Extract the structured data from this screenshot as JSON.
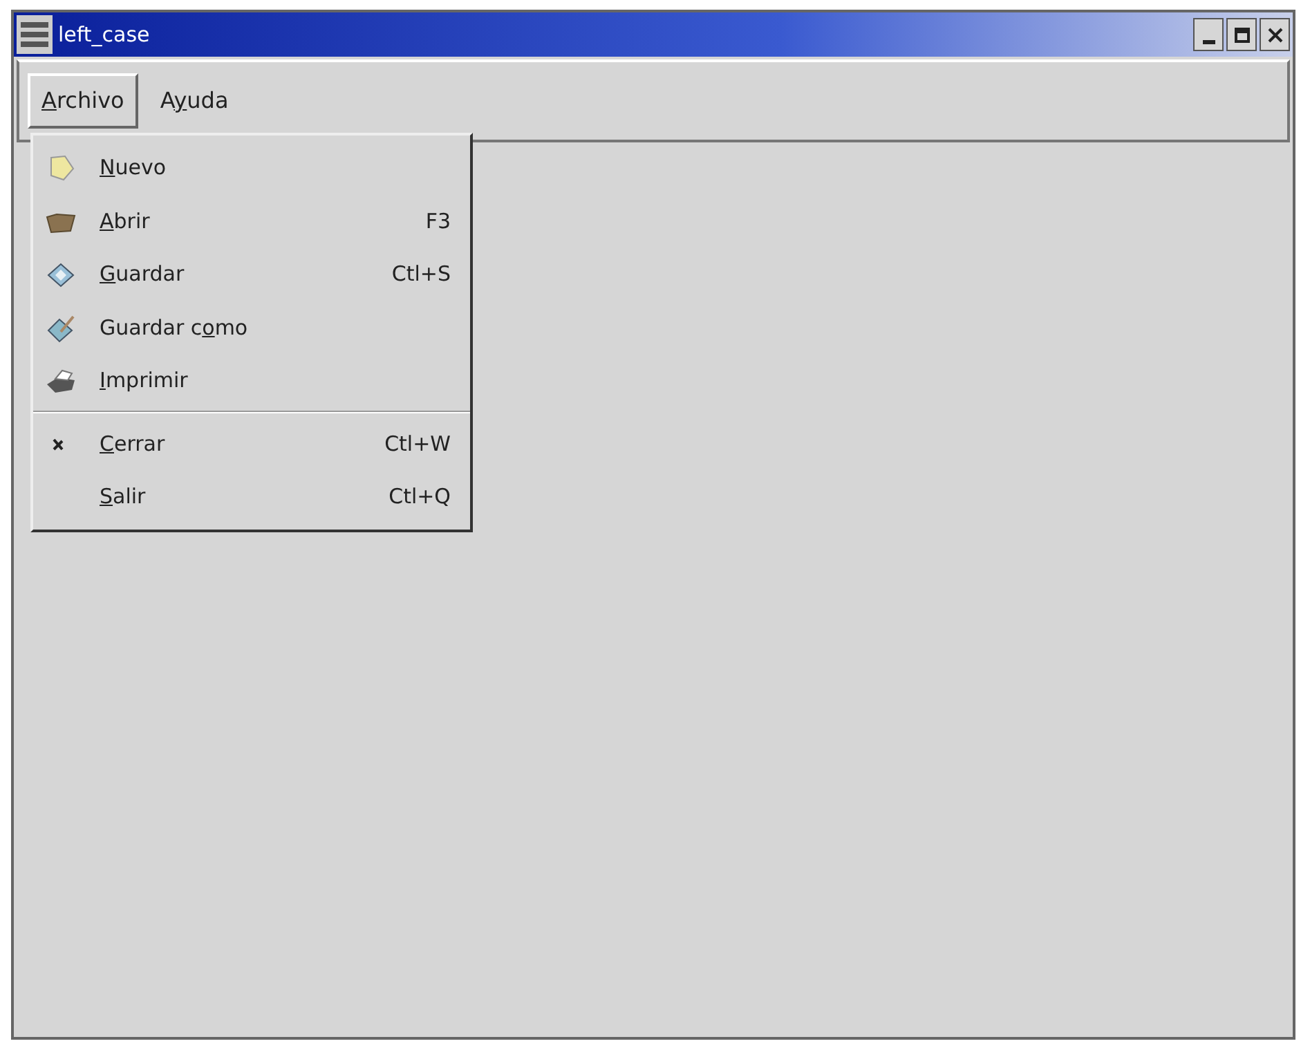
{
  "window": {
    "title": "left_case"
  },
  "menubar": [
    {
      "label": {
        "key": "A",
        "rest": "rchivo"
      },
      "selected": true
    },
    {
      "label": {
        "pre": "A",
        "key": "y",
        "rest": "uda"
      },
      "selected": false
    }
  ],
  "menu": [
    {
      "kind": "item",
      "label": {
        "key": "N",
        "rest": "uevo"
      }
    },
    {
      "kind": "item",
      "label": {
        "key": "A",
        "rest": "brir"
      },
      "shortcut": "F3"
    },
    {
      "kind": "item",
      "label": {
        "key": "G",
        "rest": "uardar"
      },
      "shortcut": "Ctl+S"
    },
    {
      "kind": "item",
      "label": {
        "pre": "Guardar c",
        "key": "o",
        "rest": "mo"
      }
    },
    {
      "kind": "item",
      "label": {
        "key": "I",
        "rest": "mprimir"
      }
    },
    {
      "kind": "separator"
    },
    {
      "kind": "item",
      "label": {
        "key": "C",
        "rest": "errar"
      },
      "shortcut": "Ctl+W"
    },
    {
      "kind": "item",
      "label": {
        "key": "S",
        "rest": "alir"
      },
      "shortcut": "Ctl+Q"
    }
  ]
}
